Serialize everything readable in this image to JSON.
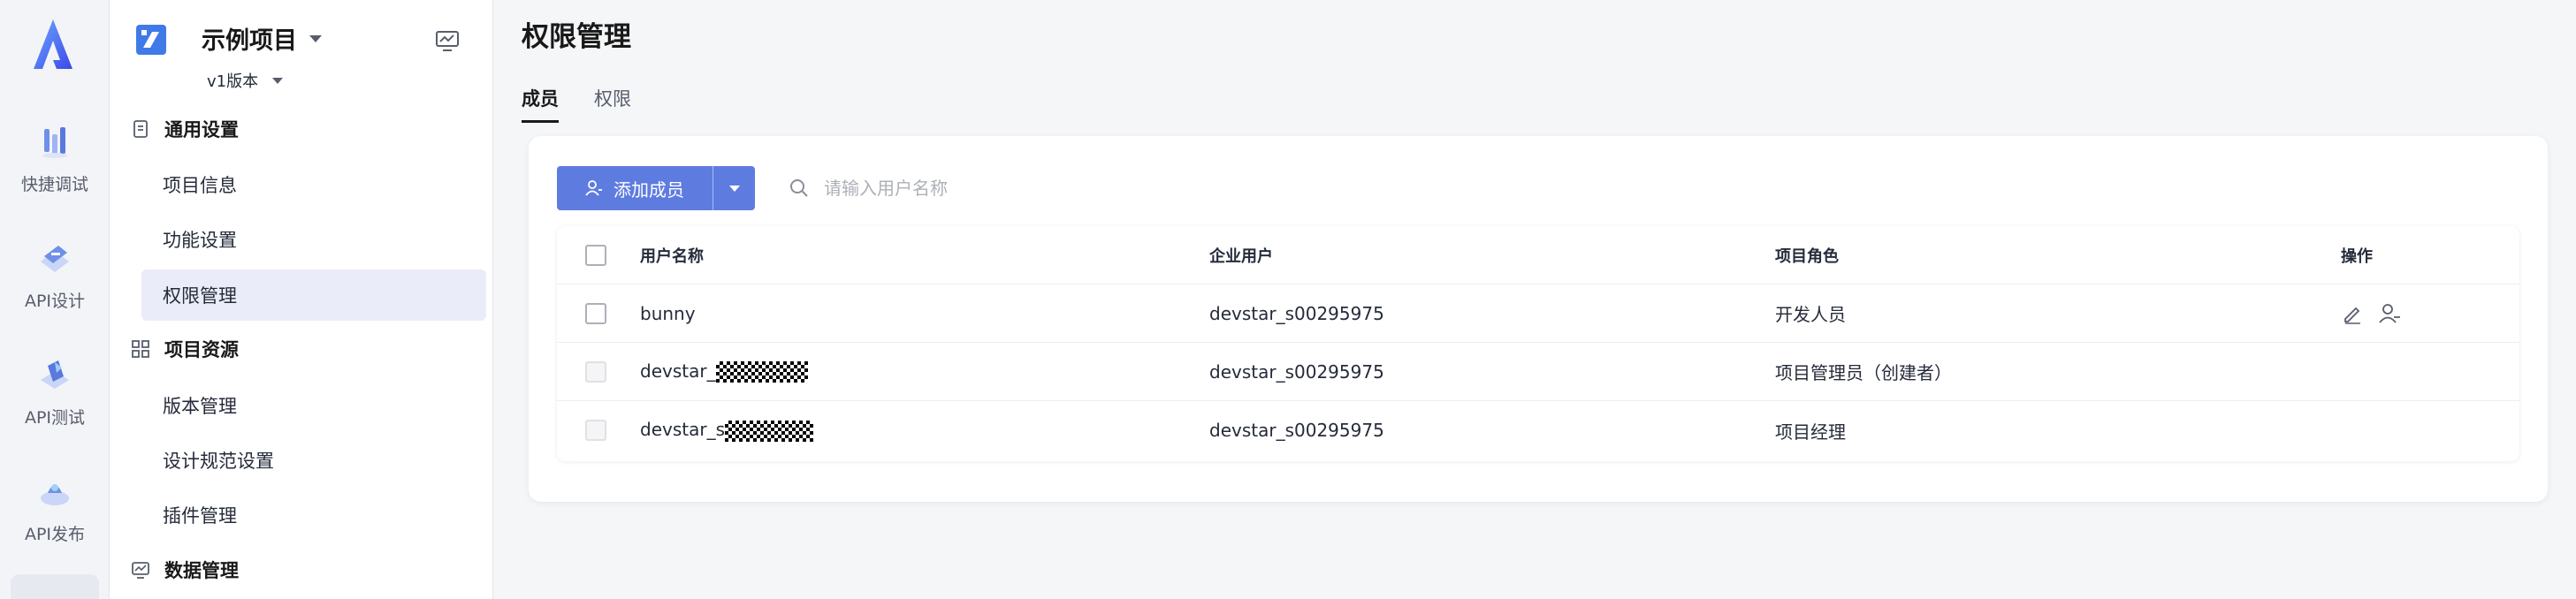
{
  "rail": {
    "items": [
      {
        "label": "快捷调试",
        "icon": "quick-debug-icon"
      },
      {
        "label": "API设计",
        "icon": "api-design-icon"
      },
      {
        "label": "API测试",
        "icon": "api-test-icon"
      },
      {
        "label": "API发布",
        "icon": "api-publish-icon"
      }
    ]
  },
  "sidebar": {
    "project_name": "示例项目",
    "version": "v1版本",
    "groups": [
      {
        "title": "通用设置",
        "items": [
          "项目信息",
          "功能设置",
          "权限管理"
        ]
      },
      {
        "title": "项目资源",
        "items": [
          "版本管理",
          "设计规范设置",
          "插件管理"
        ]
      },
      {
        "title": "数据管理",
        "items": []
      }
    ],
    "active_item": "权限管理"
  },
  "main": {
    "title": "权限管理",
    "tabs": [
      {
        "label": "成员",
        "active": true
      },
      {
        "label": "权限",
        "active": false
      }
    ],
    "add_button": "添加成员",
    "search_placeholder": "请输入用户名称",
    "table": {
      "headers": [
        "用户名称",
        "企业用户",
        "项目角色",
        "操作"
      ],
      "rows": [
        {
          "user": "bunny",
          "enterprise_user": "devstar_s00295975",
          "role": "开发人员",
          "has_actions": true
        },
        {
          "user": "devstar_",
          "enterprise_user": "devstar_s00295975",
          "role": "项目管理员（创建者）",
          "has_actions": false
        },
        {
          "user": "devstar_s",
          "enterprise_user": "devstar_s00295975",
          "role": "项目经理",
          "has_actions": false
        }
      ]
    }
  },
  "colors": {
    "accent": "#5e7ce0",
    "active_nav_bg": "#eaedf9",
    "page_bg": "#f5f6f8"
  }
}
